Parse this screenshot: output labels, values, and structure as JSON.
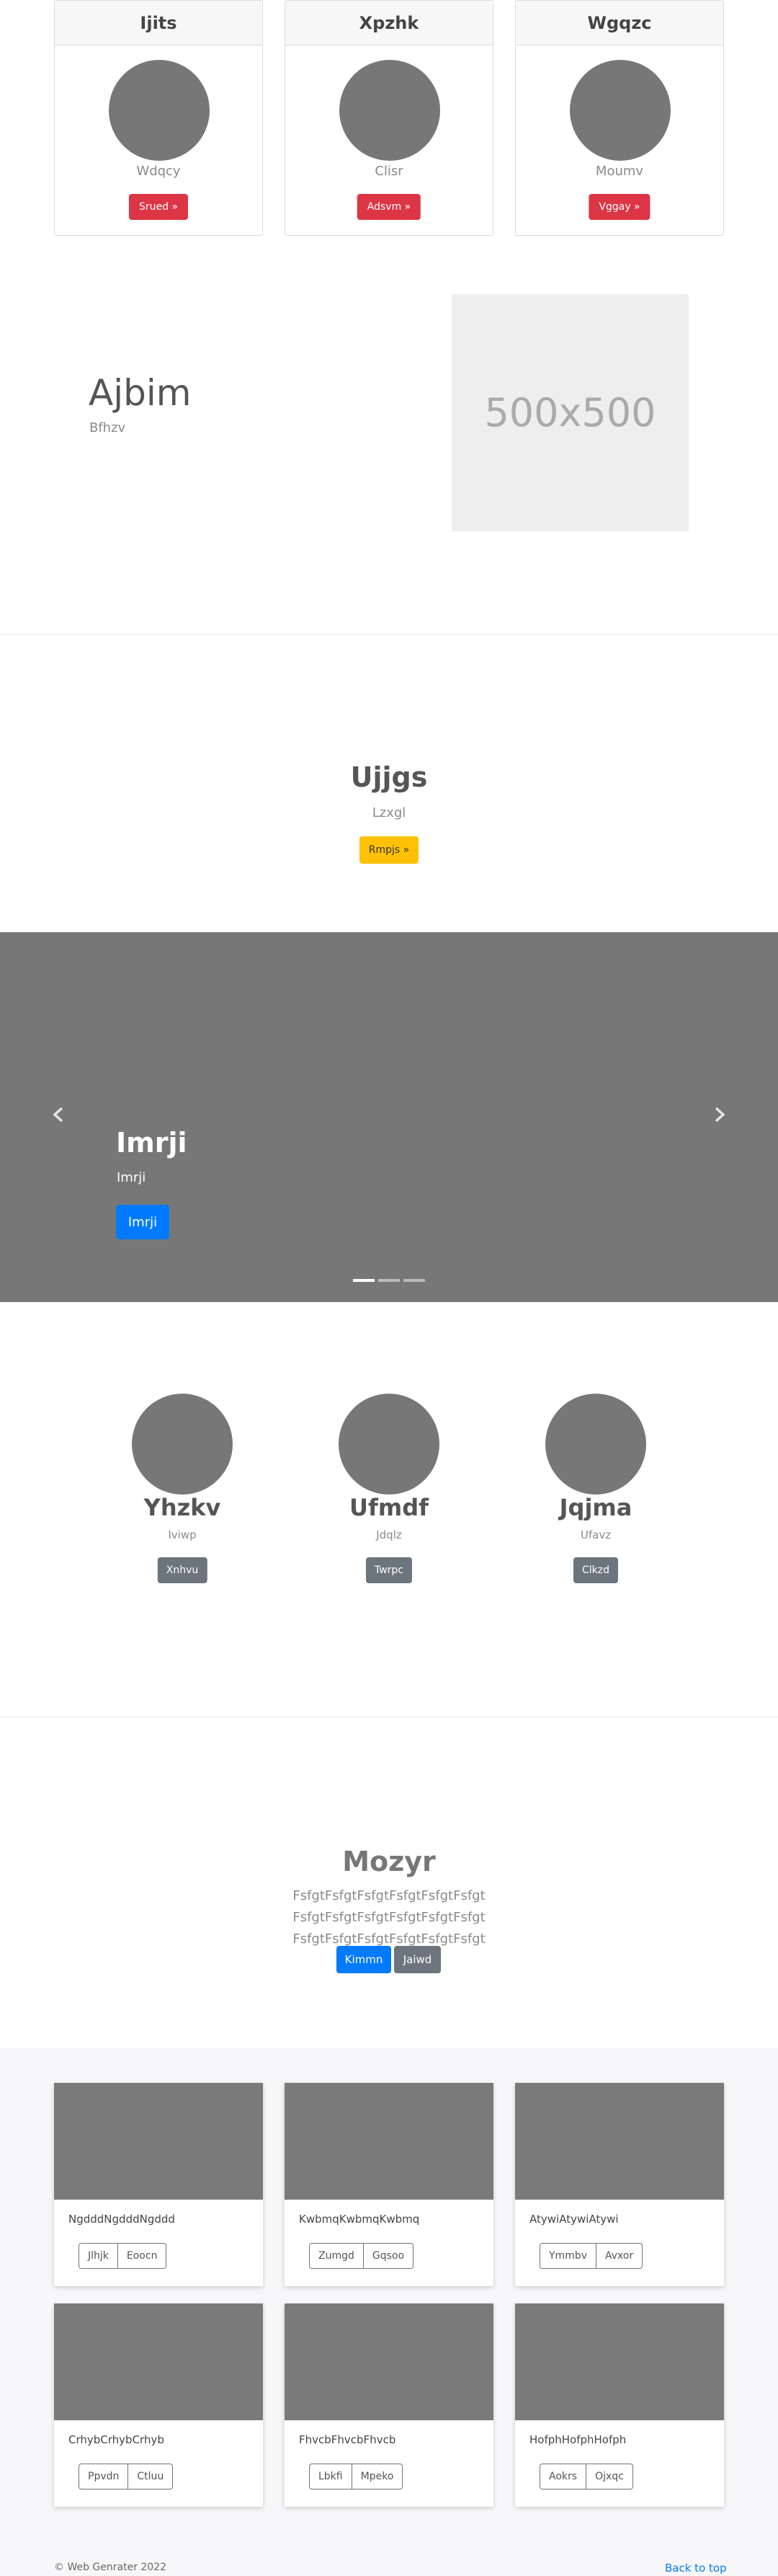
{
  "cards": [
    {
      "title": "Ijits",
      "subtitle": "Wdqcy",
      "button": "Srued »"
    },
    {
      "title": "Xpzhk",
      "subtitle": "Clisr",
      "button": "Adsvm »"
    },
    {
      "title": "Wgqzc",
      "subtitle": "Moumv",
      "button": "Vggay »"
    }
  ],
  "featurette": {
    "title": "Ajbim",
    "subtitle": "Bfhzv",
    "image_placeholder": "500x500"
  },
  "callout": {
    "title": "Ujjgs",
    "subtitle": "Lzxgl",
    "button": "Rmpjs »"
  },
  "carousel": {
    "title": "Imrji",
    "subtitle": "Imrji",
    "button": "Imrji",
    "prev_icon": "chevron-left-icon",
    "next_icon": "chevron-right-icon",
    "indicator_count": 3,
    "active_index": 0
  },
  "marketing": [
    {
      "title": "Yhzkv",
      "subtitle": "Iviwp",
      "button": "Xnhvu"
    },
    {
      "title": "Ufmdf",
      "subtitle": "Jdqlz",
      "button": "Twrpc"
    },
    {
      "title": "Jqjma",
      "subtitle": "Ufavz",
      "button": "Clkzd"
    }
  ],
  "jumbotron": {
    "title": "Mozyr",
    "lead": "FsfgtFsfgtFsfgtFsfgtFsfgtFsfgt FsfgtFsfgtFsfgtFsfgtFsfgtFsfgt FsfgtFsfgtFsfgtFsfgtFsfgtFsfgt",
    "primary_button": "Kimmn",
    "secondary_button": "Jaiwd"
  },
  "album": [
    {
      "text": "NgdddNgdddNgddd",
      "buttons": [
        "Jlhjk",
        "Eoocn"
      ]
    },
    {
      "text": "KwbmqKwbmqKwbmq",
      "buttons": [
        "Zumgd",
        "Gqsoo"
      ]
    },
    {
      "text": "AtywiAtywiAtywi",
      "buttons": [
        "Ymmbv",
        "Avxor"
      ]
    },
    {
      "text": "CrhybCrhybCrhyb",
      "buttons": [
        "Ppvdn",
        "Ctluu"
      ]
    },
    {
      "text": "FhvcbFhvcbFhvcb",
      "buttons": [
        "Lbkfi",
        "Mpeko"
      ]
    },
    {
      "text": "HofphHofphHofph",
      "buttons": [
        "Aokrs",
        "Ojxqc"
      ]
    }
  ],
  "footer": {
    "copyright": "© Web Genrater 2022",
    "back_to_top": "Back to top"
  },
  "colors": {
    "danger": "#dc3545",
    "warning": "#ffc107",
    "primary": "#007bff",
    "secondary": "#6c757d",
    "placeholder_gray": "#777777"
  }
}
